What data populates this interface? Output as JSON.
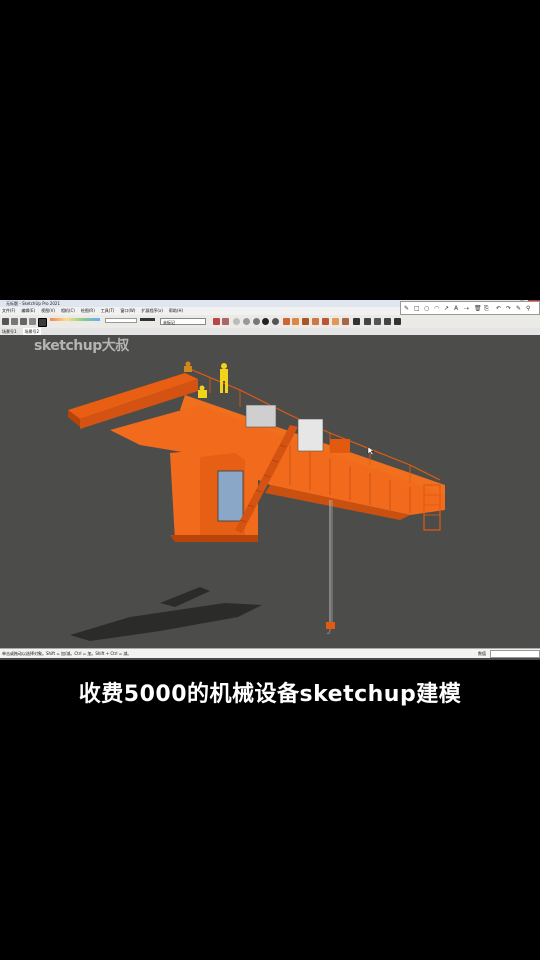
{
  "window": {
    "title": "无标题 - SketchUp Pro 2021"
  },
  "menu": {
    "items": [
      "文件(F)",
      "编辑(E)",
      "视图(V)",
      "相机(C)",
      "绘图(R)",
      "工具(T)",
      "窗口(W)",
      "扩展程序(x)",
      "帮助(H)"
    ]
  },
  "toolbar": {
    "layer_value": "未标记"
  },
  "tabs": {
    "items": [
      "场景号1",
      "场景号2"
    ],
    "active": "场景号2"
  },
  "viewport": {
    "watermark": "sketchup大叔"
  },
  "status": {
    "message": "单击或拖动以选择对象。Shift = 加/减。Ctrl = 加。Shift + Ctrl = 减。",
    "measure_label": "数值"
  },
  "caption": "收费5000的机械设备sketchup建模",
  "colors": {
    "model_orange": "#f26a1b",
    "viewport_bg": "#4c4d4a",
    "figure_yellow": "#f2d21b"
  }
}
